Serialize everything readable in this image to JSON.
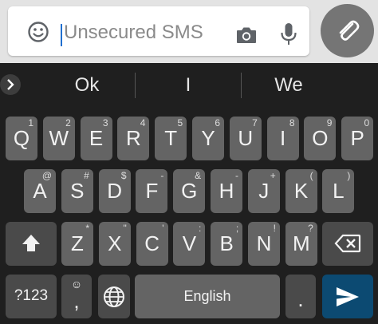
{
  "compose": {
    "placeholder": "Unsecured SMS",
    "value": ""
  },
  "suggestions": [
    "Ok",
    "I",
    "We"
  ],
  "keyboard": {
    "row1": [
      {
        "key": "Q",
        "hint": "1"
      },
      {
        "key": "W",
        "hint": "2"
      },
      {
        "key": "E",
        "hint": "3"
      },
      {
        "key": "R",
        "hint": "4"
      },
      {
        "key": "T",
        "hint": "5"
      },
      {
        "key": "Y",
        "hint": "6"
      },
      {
        "key": "U",
        "hint": "7"
      },
      {
        "key": "I",
        "hint": "8"
      },
      {
        "key": "O",
        "hint": "9"
      },
      {
        "key": "P",
        "hint": "0"
      }
    ],
    "row2": [
      {
        "key": "A",
        "hint": "@"
      },
      {
        "key": "S",
        "hint": "#"
      },
      {
        "key": "D",
        "hint": "$"
      },
      {
        "key": "F",
        "hint": "-"
      },
      {
        "key": "G",
        "hint": "&"
      },
      {
        "key": "H",
        "hint": "-"
      },
      {
        "key": "J",
        "hint": "+"
      },
      {
        "key": "K",
        "hint": "("
      },
      {
        "key": "L",
        "hint": ")"
      }
    ],
    "row3": [
      {
        "key": "Z",
        "hint": "*"
      },
      {
        "key": "X",
        "hint": "\""
      },
      {
        "key": "C",
        "hint": "'"
      },
      {
        "key": "V",
        "hint": ":"
      },
      {
        "key": "B",
        "hint": ";"
      },
      {
        "key": "N",
        "hint": "!"
      },
      {
        "key": "M",
        "hint": "?"
      }
    ],
    "symbols_label": "?123",
    "emoji_comma_top": "☺",
    "comma": ",",
    "space_label": "English",
    "period": "."
  },
  "colors": {
    "keyboard_bg": "#1f1f1f",
    "key_bg": "#646464",
    "enter_bg": "#0c4a72",
    "top_bar_bg": "#e3e3e3"
  },
  "icons": [
    "emoji-icon",
    "camera-icon",
    "mic-icon",
    "paperclip-icon",
    "chevron-right-icon",
    "shift-icon",
    "backspace-icon",
    "globe-icon",
    "send-icon"
  ]
}
